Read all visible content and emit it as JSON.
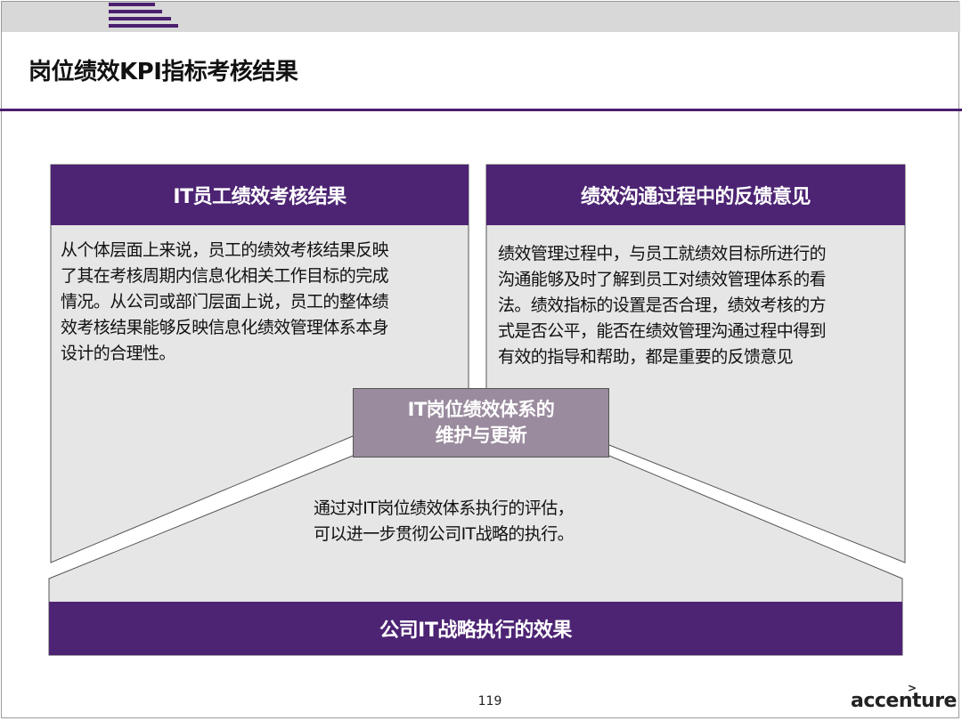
{
  "header": {
    "title": "岗位绩效KPI指标考核结果"
  },
  "left_box": {
    "heading": "IT员工绩效考核结果",
    "lines": [
      "从个体层面上来说，员工的绩效考核结果反映",
      "了其在考核周期内信息化相关工作目标的完成",
      "情况。从公司或部门层面上说，员工的整体绩",
      "效考核结果能够反映信息化绩效管理体系本身",
      "设计的合理性。"
    ]
  },
  "right_box": {
    "heading": "绩效沟通过程中的反馈意见",
    "lines": [
      "绩效管理过程中，与员工就绩效目标所进行的",
      "沟通能够及时了解到员工对绩效管理体系的看",
      "法。绩效指标的设置是否合理，绩效考核的方",
      "式是否公平，能否在绩效管理沟通过程中得到",
      "有效的指导和帮助，都是重要的反馈意见"
    ]
  },
  "center_box": {
    "line1": "IT岗位绩效体系的",
    "line2": "维护与更新"
  },
  "middle_text": {
    "line1": "通过对IT岗位绩效体系执行的评估，",
    "line2": "可以进一步贯彻公司IT战略的执行。"
  },
  "bottom_bar": {
    "label": "公司IT战略执行的效果"
  },
  "footer": {
    "page_number": "119",
    "brand": "accenture",
    "brand_mark": ">"
  },
  "colors": {
    "accent_purple": "#4d2473",
    "center_box_fill": "#9a8b9e",
    "panel_fill": "#e6e6e6"
  }
}
